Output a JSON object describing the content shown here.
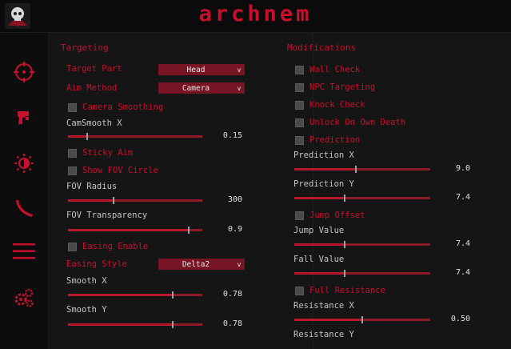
{
  "app": {
    "title": "archnem",
    "accent": "#c8102e",
    "logo_icon": "skull-logo-icon"
  },
  "sidebar": {
    "items": [
      {
        "name": "targeting",
        "icon": "crosshair-icon"
      },
      {
        "name": "weapon",
        "icon": "gun-icon"
      },
      {
        "name": "visuals",
        "icon": "sun-icon"
      },
      {
        "name": "misc",
        "icon": "bat-icon"
      },
      {
        "name": "menu",
        "icon": "hamburger-icon"
      },
      {
        "name": "settings",
        "icon": "gears-icon"
      }
    ]
  },
  "targeting": {
    "title": "Targeting",
    "target_part": {
      "label": "Target Part",
      "value": "Head"
    },
    "aim_method": {
      "label": "Aim Method",
      "value": "Camera"
    },
    "camera_smoothing": {
      "label": "Camera Smoothing",
      "checked": false
    },
    "camsmooth_x": {
      "label": "CamSmooth X",
      "value": "0.15",
      "fraction": 0.14
    },
    "sticky_aim": {
      "label": "Sticky Aim",
      "checked": false
    },
    "show_fov_circle": {
      "label": "Show FOV Circle",
      "checked": false
    },
    "fov_radius": {
      "label": "FOV Radius",
      "value": "300",
      "fraction": 0.34
    },
    "fov_transparency": {
      "label": "FOV Transparency",
      "value": "0.9",
      "fraction": 0.9
    },
    "easing_enable": {
      "label": "Easing Enable",
      "checked": false
    },
    "easing_style": {
      "label": "Easing Style",
      "value": "Delta2"
    },
    "smooth_x": {
      "label": "Smooth X",
      "value": "0.78",
      "fraction": 0.78
    },
    "smooth_y": {
      "label": "Smooth Y",
      "value": "0.78",
      "fraction": 0.78
    }
  },
  "modifications": {
    "title": "Modifications",
    "wall_check": {
      "label": "Wall Check",
      "checked": false
    },
    "npc_targeting": {
      "label": "NPC Targeting",
      "checked": false
    },
    "knock_check": {
      "label": "Knock Check",
      "checked": false
    },
    "unlock_on_own_death": {
      "label": "Unlock On Own Death",
      "checked": false
    },
    "prediction": {
      "label": "Prediction",
      "checked": false
    },
    "prediction_x": {
      "label": "Prediction X",
      "value": "9.0",
      "fraction": 0.45
    },
    "prediction_y": {
      "label": "Prediction Y",
      "value": "7.4",
      "fraction": 0.37
    },
    "jump_offset": {
      "label": "Jump Offset",
      "checked": false
    },
    "jump_value": {
      "label": "Jump Value",
      "value": "7.4",
      "fraction": 0.37
    },
    "fall_value": {
      "label": "Fall Value",
      "value": "7.4",
      "fraction": 0.37
    },
    "full_resistance": {
      "label": "Full Resistance",
      "checked": false
    },
    "resistance_x": {
      "label": "Resistance X",
      "value": "0.50",
      "fraction": 0.5
    },
    "resistance_y": {
      "label": "Resistance Y"
    }
  }
}
